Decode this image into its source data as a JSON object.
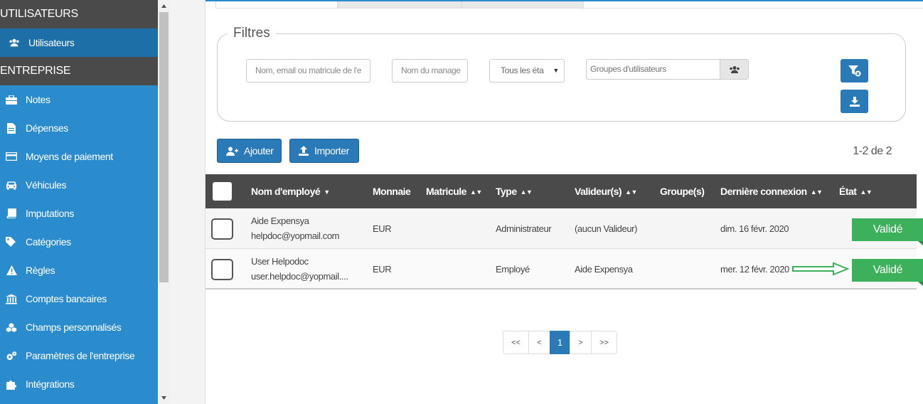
{
  "sidebar": {
    "section_users": "UTILISATEURS",
    "users_item": "Utilisateurs",
    "section_company": "ENTREPRISE",
    "items": [
      {
        "label": "Notes",
        "icon": "briefcase-icon"
      },
      {
        "label": "Dépenses",
        "icon": "document-icon"
      },
      {
        "label": "Moyens de paiement",
        "icon": "credit-card-icon"
      },
      {
        "label": "Véhicules",
        "icon": "car-icon"
      },
      {
        "label": "Imputations",
        "icon": "book-icon"
      },
      {
        "label": "Catégories",
        "icon": "tag-icon"
      },
      {
        "label": "Règles",
        "icon": "warning-icon"
      },
      {
        "label": "Comptes bancaires",
        "icon": "bank-icon"
      },
      {
        "label": "Champs personnalisés",
        "icon": "cubes-icon"
      },
      {
        "label": "Paramètres de l'entreprise",
        "icon": "cogs-icon"
      },
      {
        "label": "Intégrations",
        "icon": "puzzle-icon"
      }
    ]
  },
  "filters": {
    "legend": "Filtres",
    "search_placeholder": "Nom, email ou matricule de l'e",
    "manager_placeholder": "Nom du manage",
    "status_select": "Tous les éta",
    "groups_placeholder": "Groupes d'utilisateurs"
  },
  "actions": {
    "add_label": "Ajouter",
    "import_label": "Importer",
    "count": "1-2 de 2"
  },
  "table": {
    "headers": {
      "name": "Nom d'employé",
      "currency": "Monnaie",
      "matricule": "Matricule",
      "type": "Type",
      "validators": "Valideur(s)",
      "groups": "Groupe(s)",
      "last_login": "Dernière connexion",
      "status": "État"
    },
    "rows": [
      {
        "name": "Aide Expensya",
        "email": "helpdoc@yopmail.com",
        "currency": "EUR",
        "matricule": "",
        "type": "Administrateur",
        "validators": "(aucun Valideur)",
        "groups": "",
        "last_login": "dim. 16 févr. 2020",
        "status": "Validé"
      },
      {
        "name": "User Helpodoc",
        "email": "user.helpdoc@yopmail....",
        "currency": "EUR",
        "matricule": "",
        "type": "Employé",
        "validators": "Aide Expensya",
        "groups": "",
        "last_login": "mer. 12 févr. 2020",
        "status": "Validé"
      }
    ]
  },
  "pagination": {
    "first": "<<",
    "prev": "<",
    "current": "1",
    "next": ">",
    "last": ">>"
  },
  "colors": {
    "sidebar_bg": "#2a8ccd",
    "section_bg": "#4a4a4a",
    "primary_button": "#2a7ab8",
    "status_valid": "#3cb05a",
    "arrow": "#3cb05a"
  }
}
